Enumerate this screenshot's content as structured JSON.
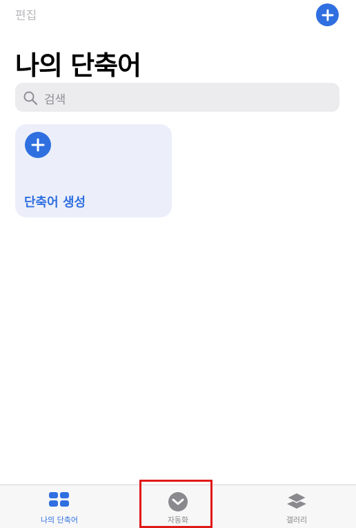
{
  "header": {
    "edit_label": "편집",
    "title": "나의 단축어"
  },
  "search": {
    "placeholder": "검색"
  },
  "card": {
    "label": "단축어 생성"
  },
  "tabs": [
    {
      "label": "나의 단축어",
      "icon": "grid-icon",
      "active": true
    },
    {
      "label": "자동화",
      "icon": "automation-check-icon",
      "active": false
    },
    {
      "label": "갤러리",
      "icon": "layers-icon",
      "active": false
    }
  ],
  "colors": {
    "accent": "#2f6fe0",
    "highlight": "#e01818",
    "inactive": "#8a8a8e"
  }
}
